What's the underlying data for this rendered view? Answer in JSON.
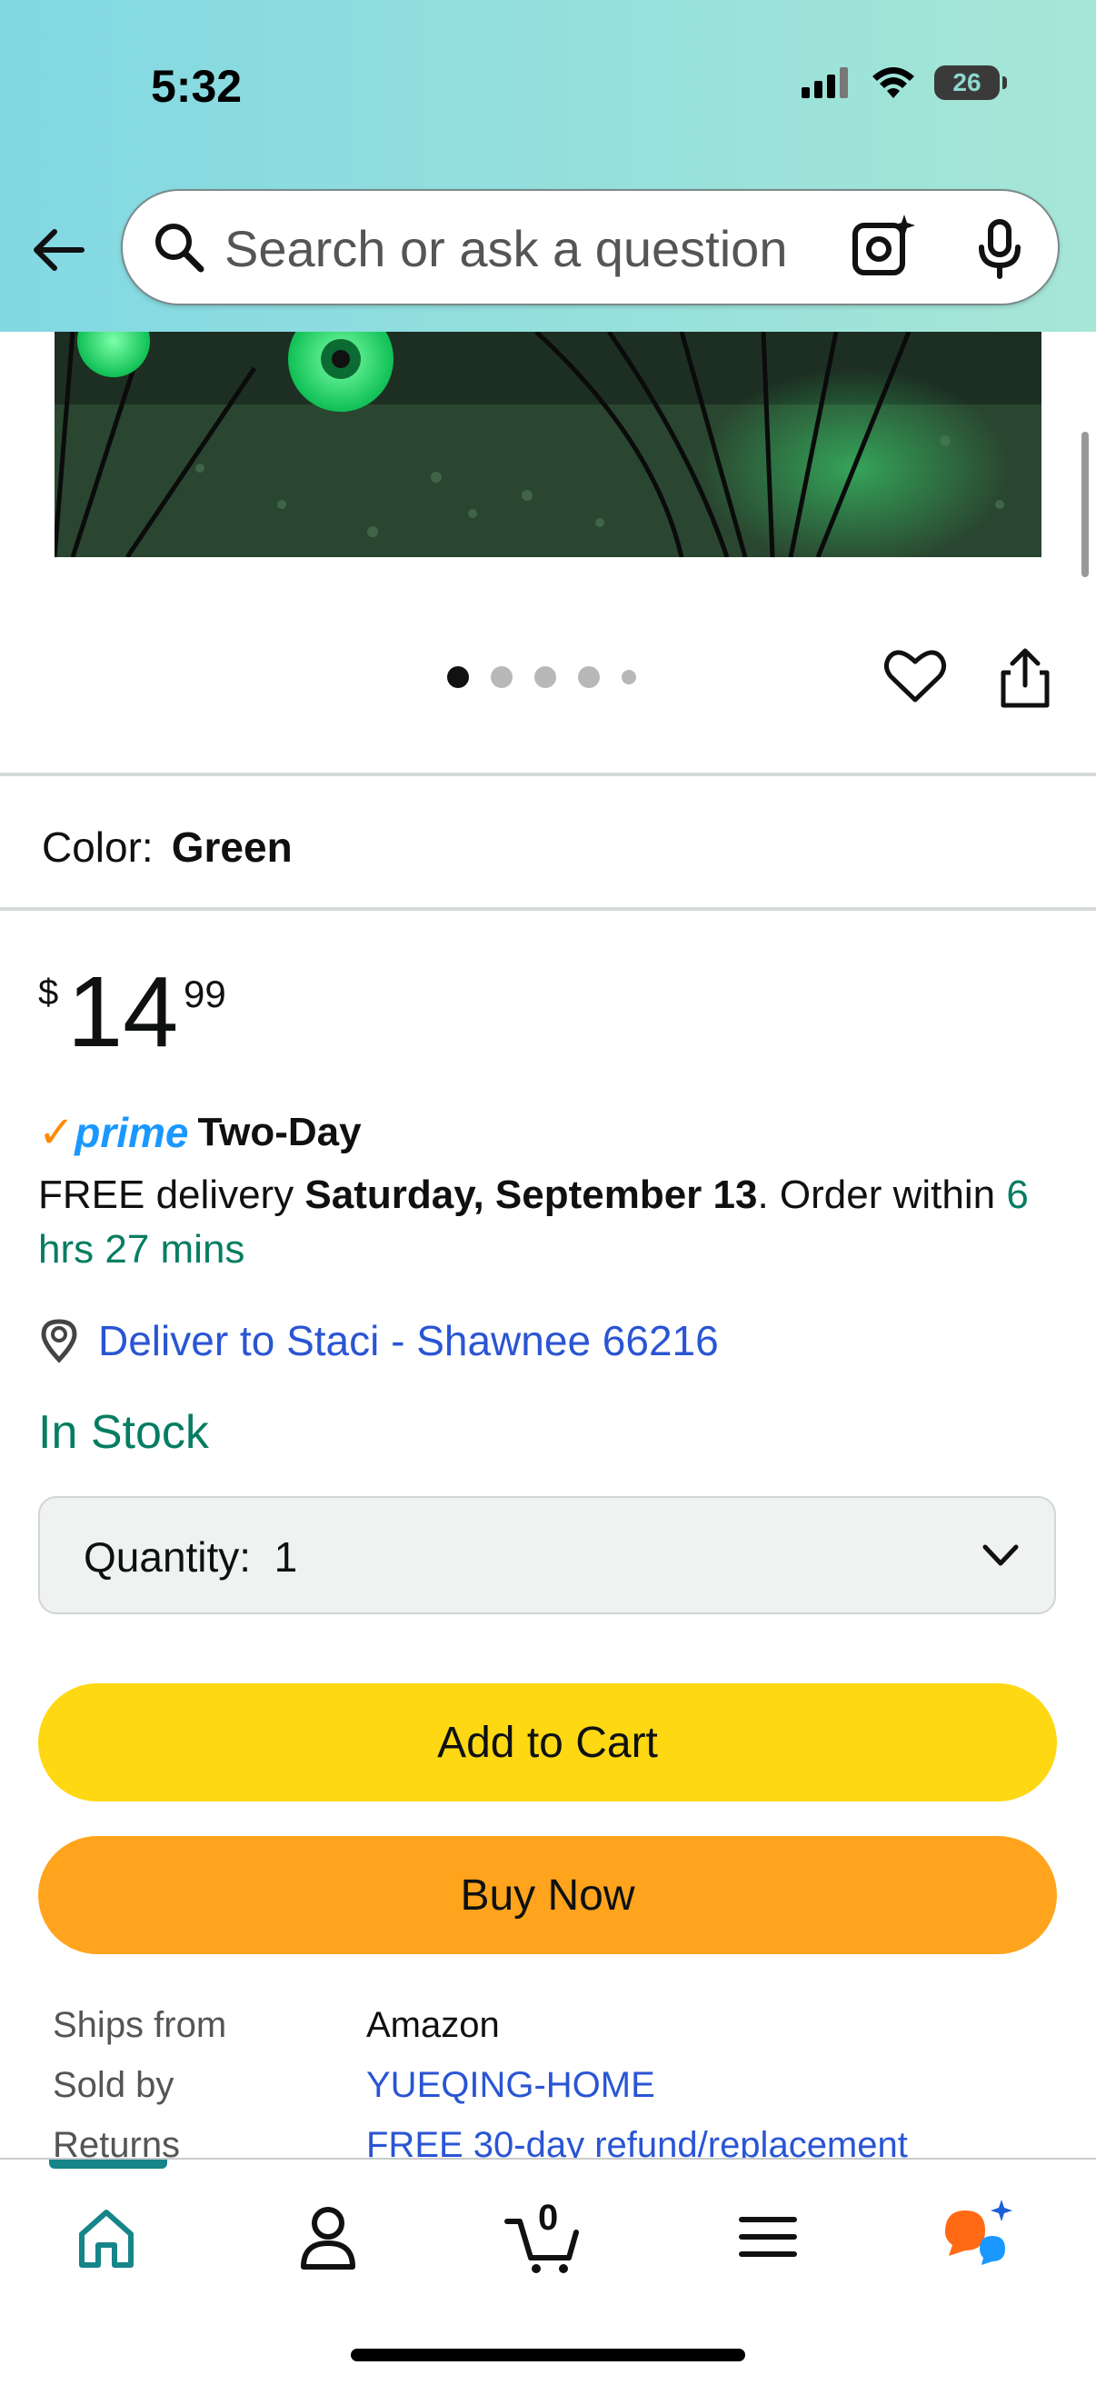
{
  "status_bar": {
    "time": "5:32",
    "battery": "26"
  },
  "search": {
    "placeholder": "Search or ask a question"
  },
  "carousel": {
    "page_count": 5,
    "active_index": 0
  },
  "color": {
    "label": "Color:",
    "value": "Green"
  },
  "price": {
    "currency": "$",
    "whole": "14",
    "fraction": "99"
  },
  "prime": {
    "logo_text": "prime",
    "check": "✓",
    "badge": "Two-Day"
  },
  "delivery": {
    "prefix": "FREE delivery ",
    "date": "Saturday, September 13",
    "mid": ". Order within ",
    "countdown": "6 hrs 27 mins"
  },
  "deliver_to": "Deliver to Staci - Shawnee 66216",
  "stock": "In Stock",
  "quantity": {
    "label": "Quantity:",
    "value": "1"
  },
  "buttons": {
    "add_to_cart": "Add to Cart",
    "buy_now": "Buy Now"
  },
  "info_rows": [
    {
      "key": "Ships from",
      "value": "Amazon"
    },
    {
      "key": "Sold by",
      "value": "YUEQING-HOME"
    },
    {
      "key": "Returns",
      "value": "FREE 30-day refund/replacement"
    }
  ],
  "tabbar": {
    "cart_count": "0",
    "active": "home"
  },
  "colors": {
    "accent": "#16858a",
    "add_to_cart": "#ffd814",
    "buy_now": "#ffa41c",
    "link": "#2a55d3",
    "in_stock": "#067d62"
  }
}
